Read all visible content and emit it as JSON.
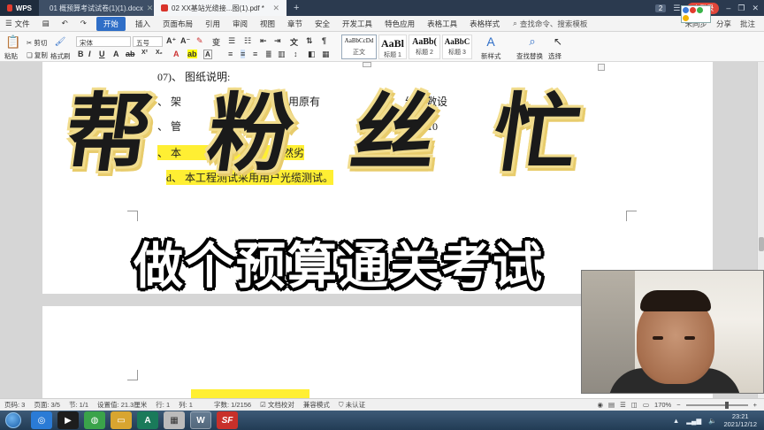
{
  "tabs": {
    "wps_label": "WPS",
    "doc_label": "01 概预算考试试卷(1)(1).docx",
    "pdf_label": "02 XX基站光缆接...图(1).pdf *",
    "add_label": "+",
    "window_count": "2",
    "login_label": "未登录"
  },
  "menu": {
    "file": "文件",
    "items": [
      "开始",
      "插入",
      "页面布局",
      "引用",
      "审阅",
      "视图",
      "章节",
      "安全",
      "开发工具",
      "特色应用",
      "表格工具",
      "表格样式"
    ],
    "search": "查找命令、搜索模板",
    "sync": "未同步",
    "share": "分享",
    "comment": "批注"
  },
  "ribbon": {
    "paste": "粘贴",
    "cut": "剪切",
    "copy": "复制",
    "format_painter": "格式刷",
    "font_name": "宋体",
    "font_size": "五号",
    "styles": [
      {
        "sample": "AaBbCcDd",
        "name": "正文"
      },
      {
        "sample": "AaBl",
        "name": "标题 1"
      },
      {
        "sample": "AaBb(",
        "name": "标题 2"
      },
      {
        "sample": "AaBbC",
        "name": "标题 3"
      }
    ],
    "new_style": "新样式",
    "find_replace": "查找替换",
    "select": "选择"
  },
  "document": {
    "lines": [
      "07)、 图纸说明:",
      "、 架",
      "、 管",
      "、 本",
      "d、 本工程测试采用用户光缆测试。"
    ],
    "fragments": {
      "line2_mid": "法（利用原有",
      "line2_end": "线）敷设",
      "line3_end": "牌 10",
      "line4_mid": "自然劣"
    }
  },
  "overlay": {
    "big_chars": [
      "帮",
      "粉",
      "丝",
      "忙"
    ],
    "subtitle": "做个预算通关考试"
  },
  "status": {
    "page": "页码: 3",
    "pages": "页面: 3/5",
    "section": "节: 1/1",
    "position": "设置值: 21.3厘米",
    "line": "行: 1",
    "column": "列: 1",
    "words": "字数: 1/2156",
    "proof": "文档校对",
    "compat": "兼容模式",
    "auth": "未认证",
    "zoom": "170%"
  },
  "taskbar": {
    "time": "23:21",
    "date": "2021/12/12"
  }
}
